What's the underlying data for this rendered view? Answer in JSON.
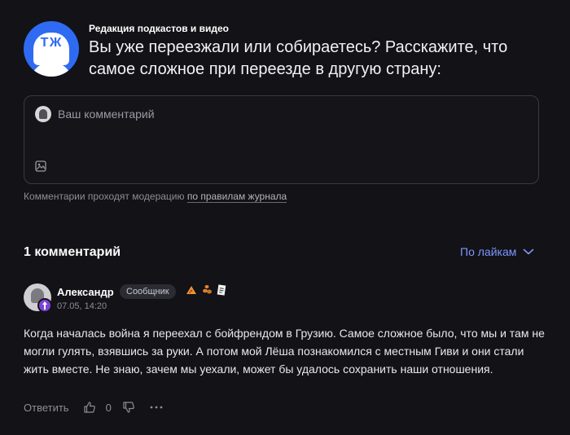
{
  "post": {
    "author": "Редакция подкастов и видео",
    "logo_text": "ТЖ",
    "question": "Вы уже переезжали или собираетесь? Расскажите, что самое сложное при переезде в другую страну:"
  },
  "comment_form": {
    "placeholder": "Ваш комментарий",
    "moderation_text": "Комментарии проходят модерацию",
    "rules_link": "по правилам журнала"
  },
  "comments_header": {
    "count_label": "1 комментарий",
    "sort_label": "По лайкам"
  },
  "comments": [
    {
      "author": "Александр",
      "role": "Сообщник",
      "time": "07.05, 14:20",
      "text": "Когда началась война я переехал с бойфрендом в Грузию. Самое сложное было, что мы и там не могли гулять, взявшись за руки. А потом мой Лёша познакомился с местным Гиви и они стали жить вместе. Не знаю, зачем мы уехали, может бы удалось сохранить наши отношения.",
      "reply_label": "Ответить",
      "likes": "0"
    }
  ],
  "colors": {
    "accent": "#7f95ff",
    "background": "#121217",
    "brand": "#2f6bf2"
  }
}
